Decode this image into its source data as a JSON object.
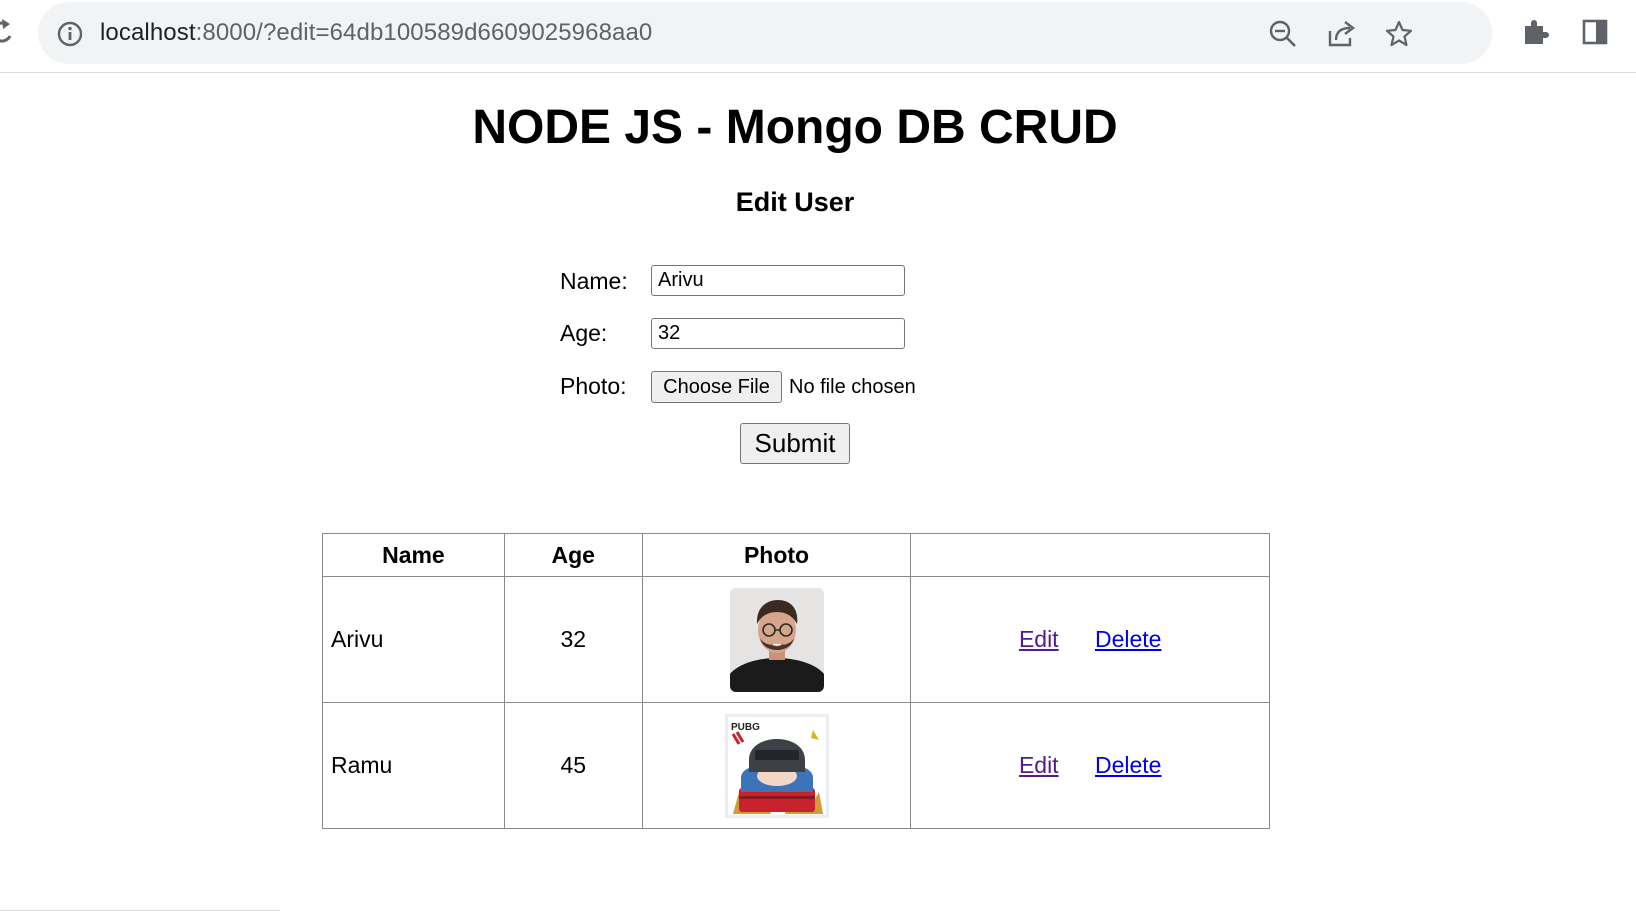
{
  "browser": {
    "url_host": "localhost",
    "url_rest": ":8000/?edit=64db100589d6609025968aa0",
    "icons": [
      "reload-icon",
      "site-info-icon",
      "zoom-out-icon",
      "share-icon",
      "bookmark-star-icon",
      "extensions-icon",
      "side-panel-icon"
    ]
  },
  "page": {
    "title": "NODE JS - Mongo DB CRUD",
    "form_title": "Edit User"
  },
  "form": {
    "name_label": "Name:",
    "name_value": "Arivu",
    "age_label": "Age:",
    "age_value": "32",
    "photo_label": "Photo:",
    "choose_file_label": "Choose File",
    "file_status": "No file chosen",
    "submit_label": "Submit"
  },
  "table": {
    "headers": [
      "Name",
      "Age",
      "Photo",
      ""
    ],
    "rows": [
      {
        "name": "Arivu",
        "age": "32",
        "photo": "portrait-photo",
        "edit": "Edit",
        "delete": "Delete"
      },
      {
        "name": "Ramu",
        "age": "45",
        "photo": "pubg-cartoon-photo",
        "edit": "Edit",
        "delete": "Delete"
      }
    ]
  },
  "colors": {
    "visited_link": "#551a8b",
    "link": "#0000ee",
    "omnibox_bg": "#f1f3f4"
  }
}
